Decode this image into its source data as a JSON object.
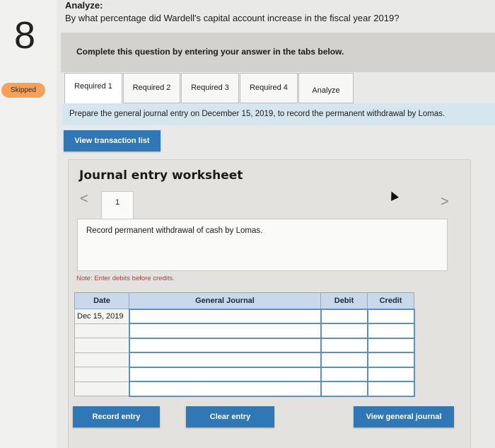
{
  "question": {
    "number": "8",
    "status": "Skipped",
    "heading": "Analyze:",
    "text": "By what percentage did Wardell's capital account increase in the fiscal year 2019?",
    "instruction": "Complete this question by entering your answer in the tabs below."
  },
  "tabs": [
    {
      "label": "Required 1"
    },
    {
      "label": "Required 2"
    },
    {
      "label": "Required 3"
    },
    {
      "label": "Required 4"
    },
    {
      "label": "Analyze"
    }
  ],
  "prompt": "Prepare the general journal entry on December 15, 2019, to record the permanent withdrawal by Lomas.",
  "buttons": {
    "view_transaction_list": "View transaction list",
    "record_entry": "Record entry",
    "clear_entry": "Clear entry",
    "view_general_journal": "View general journal"
  },
  "worksheet": {
    "title": "Journal entry worksheet",
    "page": "1",
    "prev": "<",
    "next": ">",
    "description": "Record permanent withdrawal of cash by Lomas.",
    "note": "Note: Enter debits before credits."
  },
  "journal": {
    "headers": [
      "Date",
      "General Journal",
      "Debit",
      "Credit"
    ],
    "rows": [
      [
        "Dec 15, 2019",
        "",
        "",
        ""
      ],
      [
        "",
        "",
        "",
        ""
      ],
      [
        "",
        "",
        "",
        ""
      ],
      [
        "",
        "",
        "",
        ""
      ],
      [
        "",
        "",
        "",
        ""
      ],
      [
        "",
        "",
        "",
        ""
      ]
    ]
  }
}
